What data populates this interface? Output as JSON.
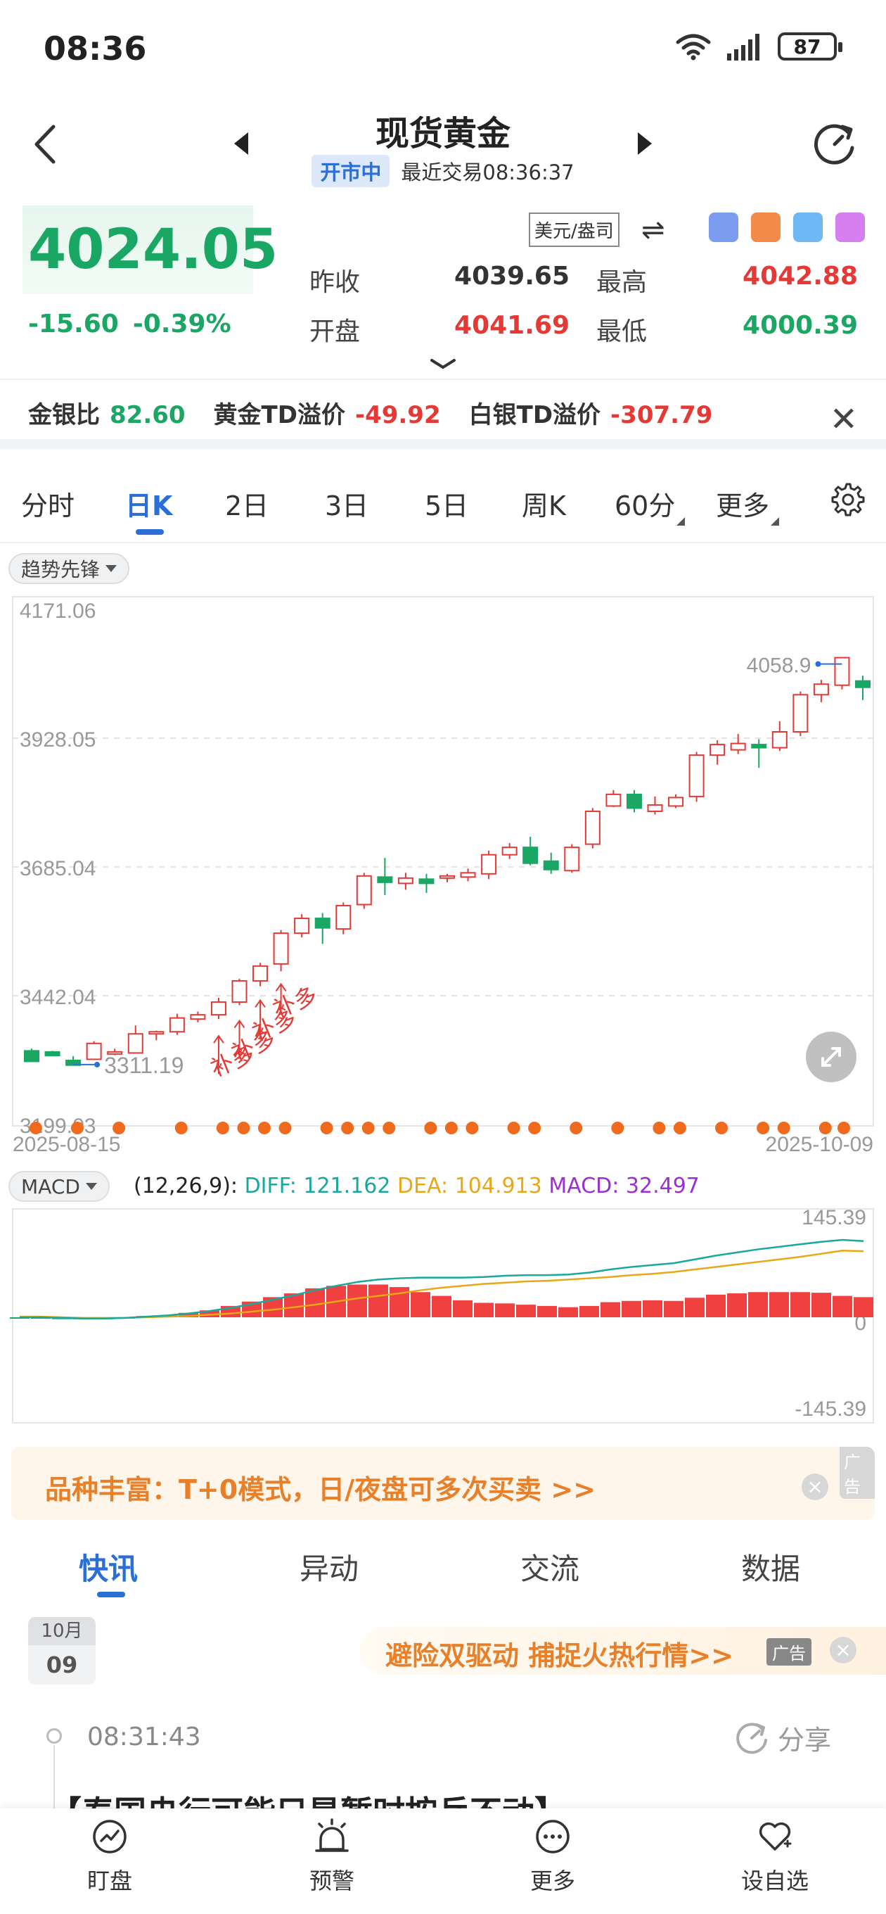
{
  "status": {
    "time": "08:36",
    "battery": "87"
  },
  "header": {
    "title": "现货黄金",
    "market_state": "开市中",
    "last_trade": "最近交易08:36:37"
  },
  "quote": {
    "price": "4024.05",
    "change": "-15.60",
    "change_pct": "-0.39%",
    "currency": "美元/盎司",
    "prev_close_label": "昨收",
    "prev_close": "4039.65",
    "high_label": "最高",
    "high": "4042.88",
    "open_label": "开盘",
    "open": "4041.69",
    "low_label": "最低",
    "low": "4000.39"
  },
  "ratios": {
    "gold_silver_label": "金银比",
    "gold_silver": "82.60",
    "gold_td_label": "黄金TD溢价",
    "gold_td": "-49.92",
    "silver_td_label": "白银TD溢价",
    "silver_td": "-307.79"
  },
  "period_tabs": [
    "分时",
    "日K",
    "2日",
    "3日",
    "5日",
    "周K",
    "60分",
    "更多"
  ],
  "active_period": "日K",
  "indicator": "趋势先锋",
  "chart_data": [
    {
      "type": "candlestick",
      "y_ticks": [
        "4171.06",
        "3928.05",
        "3685.04",
        "3442.04",
        "3199.03"
      ],
      "ylim": [
        3199.03,
        4171.06
      ],
      "x_start": "2025-08-15",
      "x_end": "2025-10-09",
      "max_label": "4058.9",
      "min_label": "3311.19",
      "annotation": "补多",
      "candles": [
        [
          3338,
          3342,
          3322,
          3318
        ],
        [
          3336,
          3338,
          3330,
          3329
        ],
        [
          3320,
          3328,
          3312,
          3311
        ],
        [
          3322,
          3356,
          3347,
          3352
        ],
        [
          3332,
          3342,
          3330,
          3336
        ],
        [
          3334,
          3386,
          3340,
          3370
        ],
        [
          3370,
          3376,
          3358,
          3374
        ],
        [
          3374,
          3408,
          3368,
          3400
        ],
        [
          3398,
          3412,
          3392,
          3406
        ],
        [
          3406,
          3438,
          3398,
          3430
        ],
        [
          3430,
          3474,
          3424,
          3470
        ],
        [
          3470,
          3504,
          3460,
          3498
        ],
        [
          3502,
          3566,
          3488,
          3560
        ],
        [
          3560,
          3596,
          3552,
          3588
        ],
        [
          3588,
          3598,
          3540,
          3570
        ],
        [
          3568,
          3618,
          3558,
          3612
        ],
        [
          3614,
          3674,
          3606,
          3668
        ],
        [
          3666,
          3702,
          3632,
          3656
        ],
        [
          3654,
          3674,
          3642,
          3664
        ],
        [
          3662,
          3672,
          3636,
          3654
        ],
        [
          3664,
          3672,
          3656,
          3668
        ],
        [
          3666,
          3682,
          3658,
          3674
        ],
        [
          3672,
          3716,
          3662,
          3708
        ],
        [
          3708,
          3730,
          3700,
          3722
        ],
        [
          3722,
          3742,
          3688,
          3692
        ],
        [
          3696,
          3712,
          3672,
          3680
        ],
        [
          3678,
          3728,
          3674,
          3722
        ],
        [
          3728,
          3796,
          3720,
          3790
        ],
        [
          3800,
          3830,
          3798,
          3822
        ],
        [
          3822,
          3830,
          3788,
          3796
        ],
        [
          3790,
          3818,
          3784,
          3802
        ],
        [
          3800,
          3822,
          3796,
          3816
        ],
        [
          3818,
          3902,
          3808,
          3896
        ],
        [
          3896,
          3924,
          3878,
          3916
        ],
        [
          3906,
          3936,
          3898,
          3918
        ],
        [
          3916,
          3926,
          3872,
          3910
        ],
        [
          3910,
          3960,
          3904,
          3940
        ],
        [
          3940,
          4016,
          3932,
          4010
        ],
        [
          4010,
          4038,
          3996,
          4030
        ],
        [
          4028,
          4068,
          4020,
          4080
        ],
        [
          4036,
          4046,
          4000,
          4024
        ]
      ],
      "markers": [
        0,
        2,
        4,
        7,
        9,
        10,
        11,
        12,
        14,
        15,
        16,
        17,
        19,
        20,
        21,
        23,
        24,
        26,
        28,
        30,
        31,
        33,
        35,
        36,
        38,
        40
      ]
    },
    {
      "type": "macd",
      "title": "MACD",
      "params": "(12,26,9):",
      "diff_label": "DIFF:",
      "diff": "121.162",
      "dea_label": "DEA:",
      "dea": "104.913",
      "macd_label": "MACD:",
      "macd": "32.497",
      "ylim": [
        -145.39,
        145.39
      ],
      "y_ticks": [
        "145.39",
        "0",
        "-145.39"
      ],
      "diff_series": [
        0,
        0,
        -1,
        -2,
        -2,
        -1,
        1,
        3,
        6,
        10,
        15,
        21,
        28,
        35,
        43,
        50,
        56,
        60,
        62,
        63,
        63,
        63,
        64,
        66,
        67,
        67,
        68,
        71,
        76,
        80,
        83,
        86,
        92,
        98,
        103,
        108,
        112,
        116,
        120,
        123,
        121
      ],
      "dea_series": [
        1,
        1,
        0,
        -1,
        -1,
        -1,
        0,
        1,
        2,
        4,
        6,
        9,
        12,
        16,
        20,
        25,
        30,
        34,
        38,
        43,
        47,
        50,
        53,
        55,
        57,
        58,
        60,
        62,
        64,
        67,
        69,
        72,
        76,
        80,
        84,
        88,
        92,
        96,
        101,
        106,
        105
      ],
      "macd_series": [
        -2,
        -2,
        -3,
        -3,
        -3,
        -1,
        2,
        3,
        7,
        11,
        18,
        25,
        32,
        38,
        46,
        50,
        52,
        52,
        48,
        40,
        34,
        27,
        23,
        22,
        20,
        18,
        16,
        18,
        24,
        26,
        27,
        26,
        31,
        36,
        38,
        40,
        40,
        40,
        39,
        34,
        32
      ]
    }
  ],
  "ad": {
    "text": "品种丰富：T+0模式，日/夜盘可多次买卖 >>",
    "tag": "广告",
    "close": "×"
  },
  "news_tabs": [
    "快讯",
    "异动",
    "交流",
    "数据"
  ],
  "feed": {
    "month": "10月",
    "day": "09",
    "promo": "避险双驱动 捕捉火热行情>>",
    "promo_tag": "广告",
    "promo_close": "×",
    "time": "08:31:43",
    "share": "分享",
    "headline": "【泰国央行可能只是暂时按兵不动】"
  },
  "bottom_nav": [
    "盯盘",
    "预警",
    "更多",
    "设自选"
  ],
  "colors": {
    "up": "#e53935",
    "down": "#1aa663",
    "accent": "#2a6fd6",
    "marker": "#f06a1e",
    "diff": "#19a89d",
    "dea": "#e6a817"
  }
}
